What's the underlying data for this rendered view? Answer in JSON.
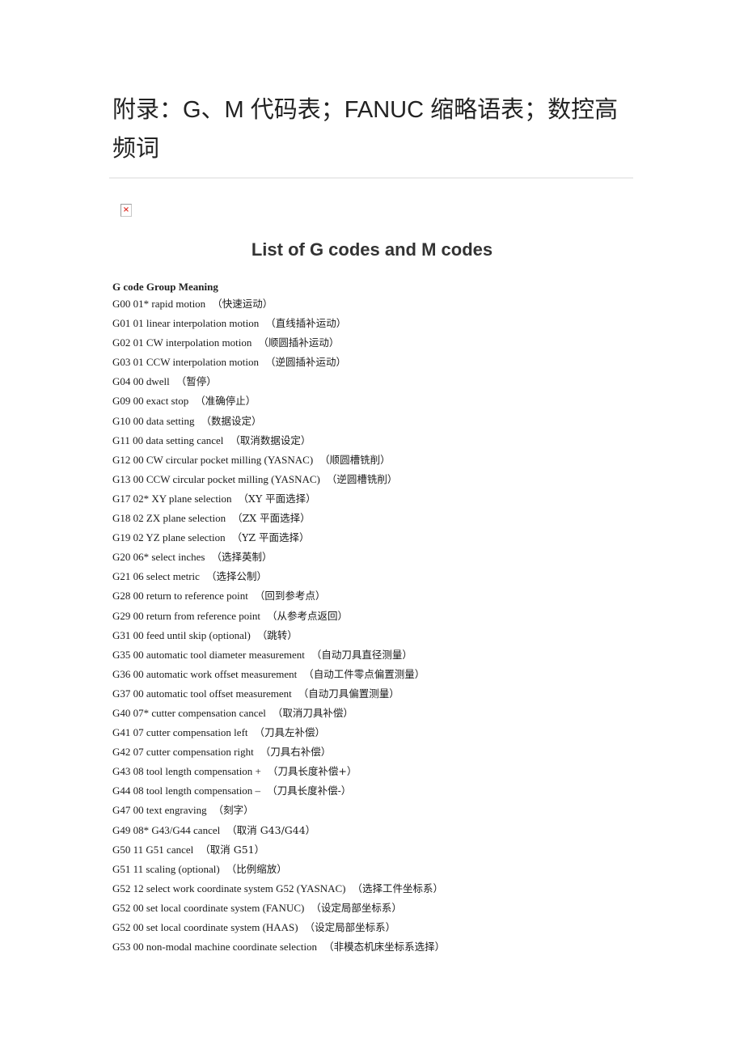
{
  "document": {
    "title": "附录：G、M 代码表；FANUC 缩略语表；数控高频词",
    "image_placeholder_icon": "broken-image-icon",
    "image_placeholder_glyph": "×",
    "list_title": "List of G codes and M codes",
    "table_header": "G code Group Meaning",
    "codes": [
      {
        "en": "G00 01* rapid motion",
        "cn": "（快速运动）"
      },
      {
        "en": "G01 01 linear interpolation motion",
        "cn": "（直线插补运动）"
      },
      {
        "en": "G02 01 CW interpolation motion",
        "cn": "（顺圆插补运动）"
      },
      {
        "en": "G03 01 CCW interpolation motion",
        "cn": "（逆圆插补运动）"
      },
      {
        "en": "G04 00 dwell",
        "cn": "（暂停）"
      },
      {
        "en": "G09 00 exact stop",
        "cn": "（准确停止）"
      },
      {
        "en": "G10 00 data setting",
        "cn": "（数据设定）"
      },
      {
        "en": "G11 00 data setting cancel",
        "cn": "（取消数据设定）"
      },
      {
        "en": "G12 00 CW circular pocket milling (YASNAC)",
        "cn": "（顺圆槽铣削）"
      },
      {
        "en": "G13 00 CCW circular pocket milling (YASNAC)",
        "cn": "（逆圆槽铣削）"
      },
      {
        "en": "G17 02* XY plane selection",
        "cn": "（XY 平面选择）"
      },
      {
        "en": "G18 02 ZX plane selection",
        "cn": "（ZX 平面选择）"
      },
      {
        "en": "G19 02 YZ plane selection",
        "cn": "（YZ 平面选择）"
      },
      {
        "en": "G20 06* select inches",
        "cn": "（选择英制）"
      },
      {
        "en": "G21 06 select metric",
        "cn": "（选择公制）"
      },
      {
        "en": "G28 00 return to reference point",
        "cn": "（回到参考点）"
      },
      {
        "en": "G29 00 return from reference point",
        "cn": "（从参考点返回）"
      },
      {
        "en": "G31 00 feed until skip (optional)",
        "cn": "（跳转）"
      },
      {
        "en": "G35 00 automatic tool diameter measurement",
        "cn": "（自动刀具直径测量）"
      },
      {
        "en": "G36 00 automatic work offset measurement",
        "cn": "（自动工件零点偏置测量）"
      },
      {
        "en": "G37 00 automatic tool offset measurement",
        "cn": "（自动刀具偏置测量）"
      },
      {
        "en": "G40 07* cutter compensation cancel",
        "cn": "（取消刀具补偿）"
      },
      {
        "en": "G41 07 cutter compensation left",
        "cn": "（刀具左补偿）"
      },
      {
        "en": "G42 07 cutter compensation right",
        "cn": "（刀具右补偿）"
      },
      {
        "en": "G43 08 tool length compensation +",
        "cn": "（刀具长度补偿+）"
      },
      {
        "en": "G44 08 tool length compensation –",
        "cn": "（刀具长度补偿-）"
      },
      {
        "en": "G47 00 text engraving",
        "cn": "（刻字）"
      },
      {
        "en": "G49 08* G43/G44 cancel",
        "cn": "（取消 G43/G44）"
      },
      {
        "en": "G50 11 G51 cancel",
        "cn": "（取消 G51）"
      },
      {
        "en": "G51 11 scaling (optional)",
        "cn": "（比例缩放）"
      },
      {
        "en": "G52 12 select work coordinate system G52 (YASNAC)",
        "cn": "（选择工件坐标系）"
      },
      {
        "en": "G52 00 set local coordinate system (FANUC)",
        "cn": "（设定局部坐标系）"
      },
      {
        "en": "G52 00 set local coordinate system (HAAS)",
        "cn": "（设定局部坐标系）"
      },
      {
        "en": "G53 00 non-modal machine coordinate selection",
        "cn": "（非模态机床坐标系选择）"
      }
    ]
  }
}
